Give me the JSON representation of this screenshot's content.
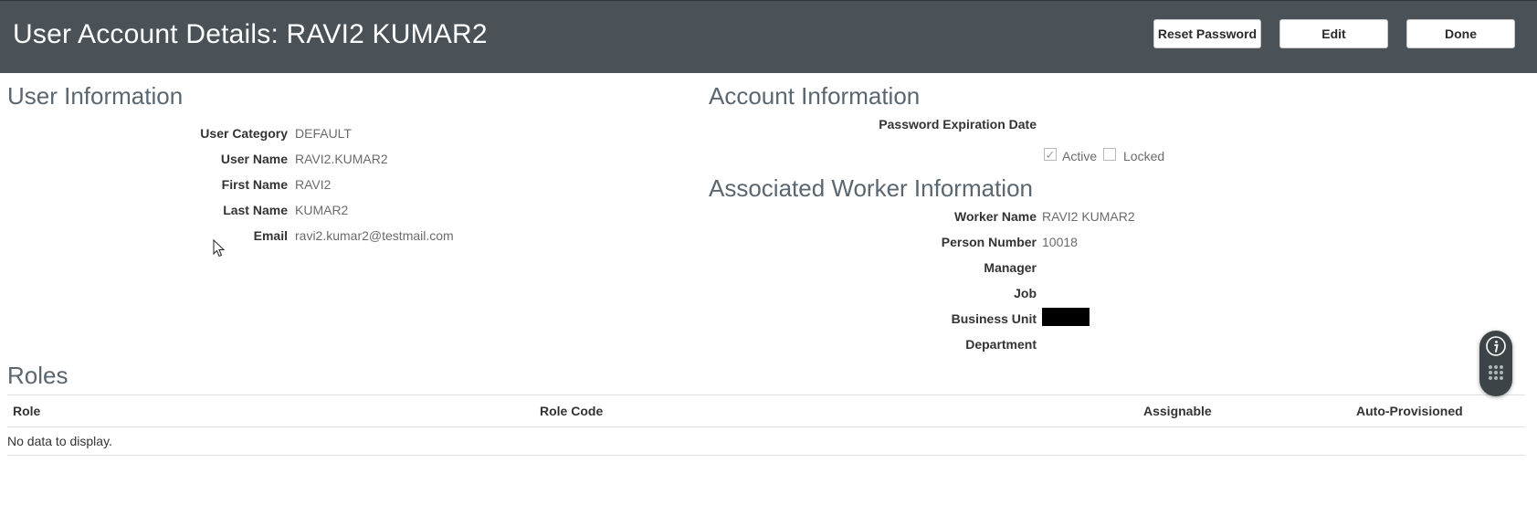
{
  "header": {
    "title": "User Account Details: RAVI2 KUMAR2",
    "buttons": {
      "reset_password": "Reset Password",
      "edit": "Edit",
      "done": "Done"
    }
  },
  "user_information": {
    "title": "User Information",
    "fields": [
      {
        "label": "User Category",
        "value": "DEFAULT"
      },
      {
        "label": "User Name",
        "value": "RAVI2.KUMAR2"
      },
      {
        "label": "First Name",
        "value": "RAVI2"
      },
      {
        "label": "Last Name",
        "value": "KUMAR2"
      },
      {
        "label": "Email",
        "value": "ravi2.kumar2@testmail.com"
      }
    ]
  },
  "account_information": {
    "title": "Account Information",
    "password_expiration_label": "Password Expiration Date",
    "password_expiration_value": "",
    "active_label": "Active",
    "active_checked": true,
    "locked_label": "Locked",
    "locked_checked": false
  },
  "associated_worker": {
    "title": "Associated Worker Information",
    "fields": [
      {
        "label": "Worker Name",
        "value": "RAVI2 KUMAR2"
      },
      {
        "label": "Person Number",
        "value": "10018"
      },
      {
        "label": "Manager",
        "value": ""
      },
      {
        "label": "Job",
        "value": ""
      },
      {
        "label": "Business Unit",
        "value": "[redacted]"
      },
      {
        "label": "Department",
        "value": ""
      }
    ]
  },
  "roles": {
    "title": "Roles",
    "columns": [
      "Role",
      "Role Code",
      "Assignable",
      "Auto-Provisioned"
    ],
    "empty_text": "No data to display."
  },
  "icons": {
    "info": "info-icon",
    "grid": "grid-dots-icon",
    "cursor": "mouse-pointer-icon"
  },
  "colors": {
    "header_bg": "#4a5257",
    "section_title": "#5a6670"
  }
}
